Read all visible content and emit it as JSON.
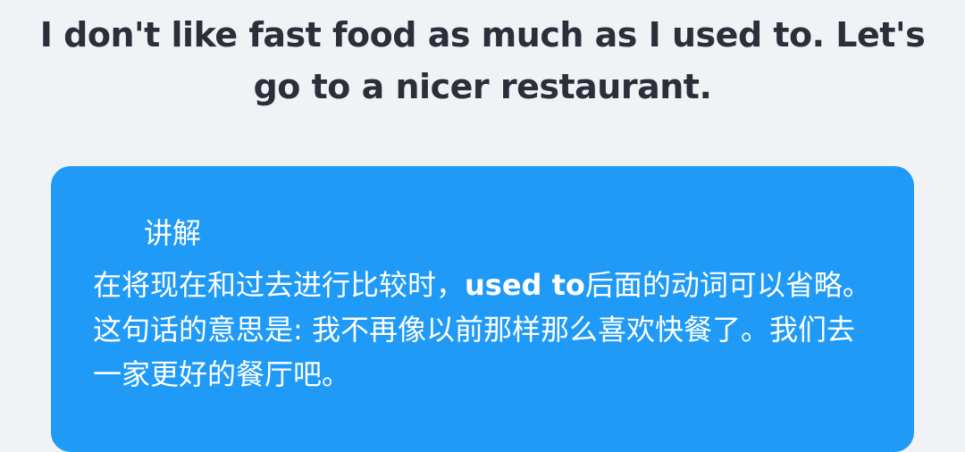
{
  "sentence": {
    "text": "I don't like fast food as much as I used to. Let's go to a nicer restaurant."
  },
  "explanation": {
    "title": "讲解",
    "body_before": "在将现在和过去进行比较时，",
    "body_bold": "used to",
    "body_after": "后面的动词可以省略。这句话的意思是: 我不再像以前那样那么喜欢快餐了。我们去一家更好的餐厅吧。"
  },
  "colors": {
    "background": "#f1f2f5",
    "card": "#1f9af7",
    "sentence_text": "#2b2f3a",
    "card_text": "#ffffff"
  }
}
